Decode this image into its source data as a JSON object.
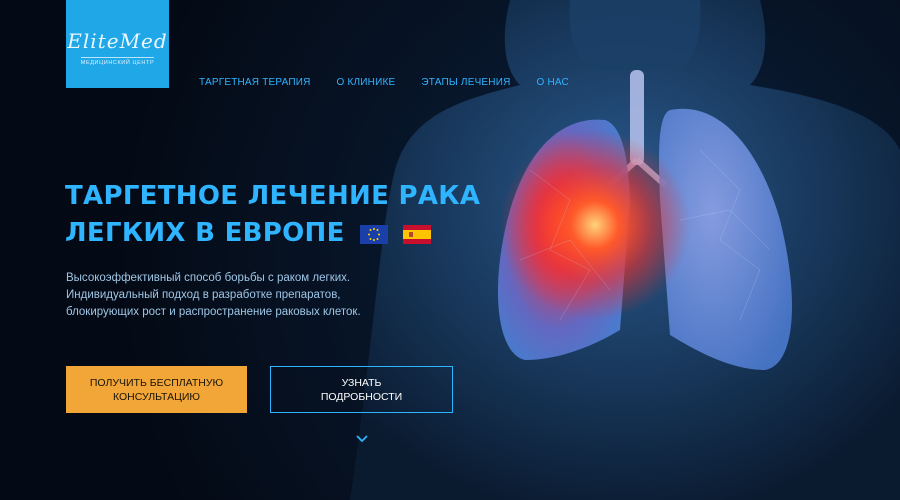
{
  "logo": {
    "script_text": "EliteMed",
    "sub_text": "МЕДИЦИНСКИЙ ЦЕНТР"
  },
  "nav": {
    "items": [
      {
        "label": "ТАРГЕТНАЯ ТЕРАПИЯ"
      },
      {
        "label": "О КЛИНИКЕ"
      },
      {
        "label": "ЭТАПЫ ЛЕЧЕНИЯ"
      },
      {
        "label": "О НАС"
      }
    ]
  },
  "hero": {
    "headline_line1": "ТАРГЕТНОЕ ЛЕЧЕНИЕ РАКА",
    "headline_line2": "ЛЕГКИХ В ЕВРОПЕ",
    "flags": [
      "eu-flag-icon",
      "spain-flag-icon"
    ],
    "description_lines": [
      "Высокоэффективный способ борьбы с раком легких.",
      "Индивидуальный подход в разработке препаратов,",
      "блокирующих рост и распространение раковых клеток."
    ],
    "cta_primary": "ПОЛУЧИТЬ БЕСПЛАТНУЮ КОНСУЛЬТАЦИЮ",
    "cta_secondary": "УЗНАТЬ ПОДРОБНОСТИ"
  },
  "colors": {
    "accent_blue": "#2fb4ff",
    "logo_bg": "#1fa7e8",
    "cta_orange": "#f2a637",
    "background": "#050c18",
    "tumor_glow": "#ff3b2a"
  },
  "icons": {
    "scroll": "chevron-down-icon"
  }
}
